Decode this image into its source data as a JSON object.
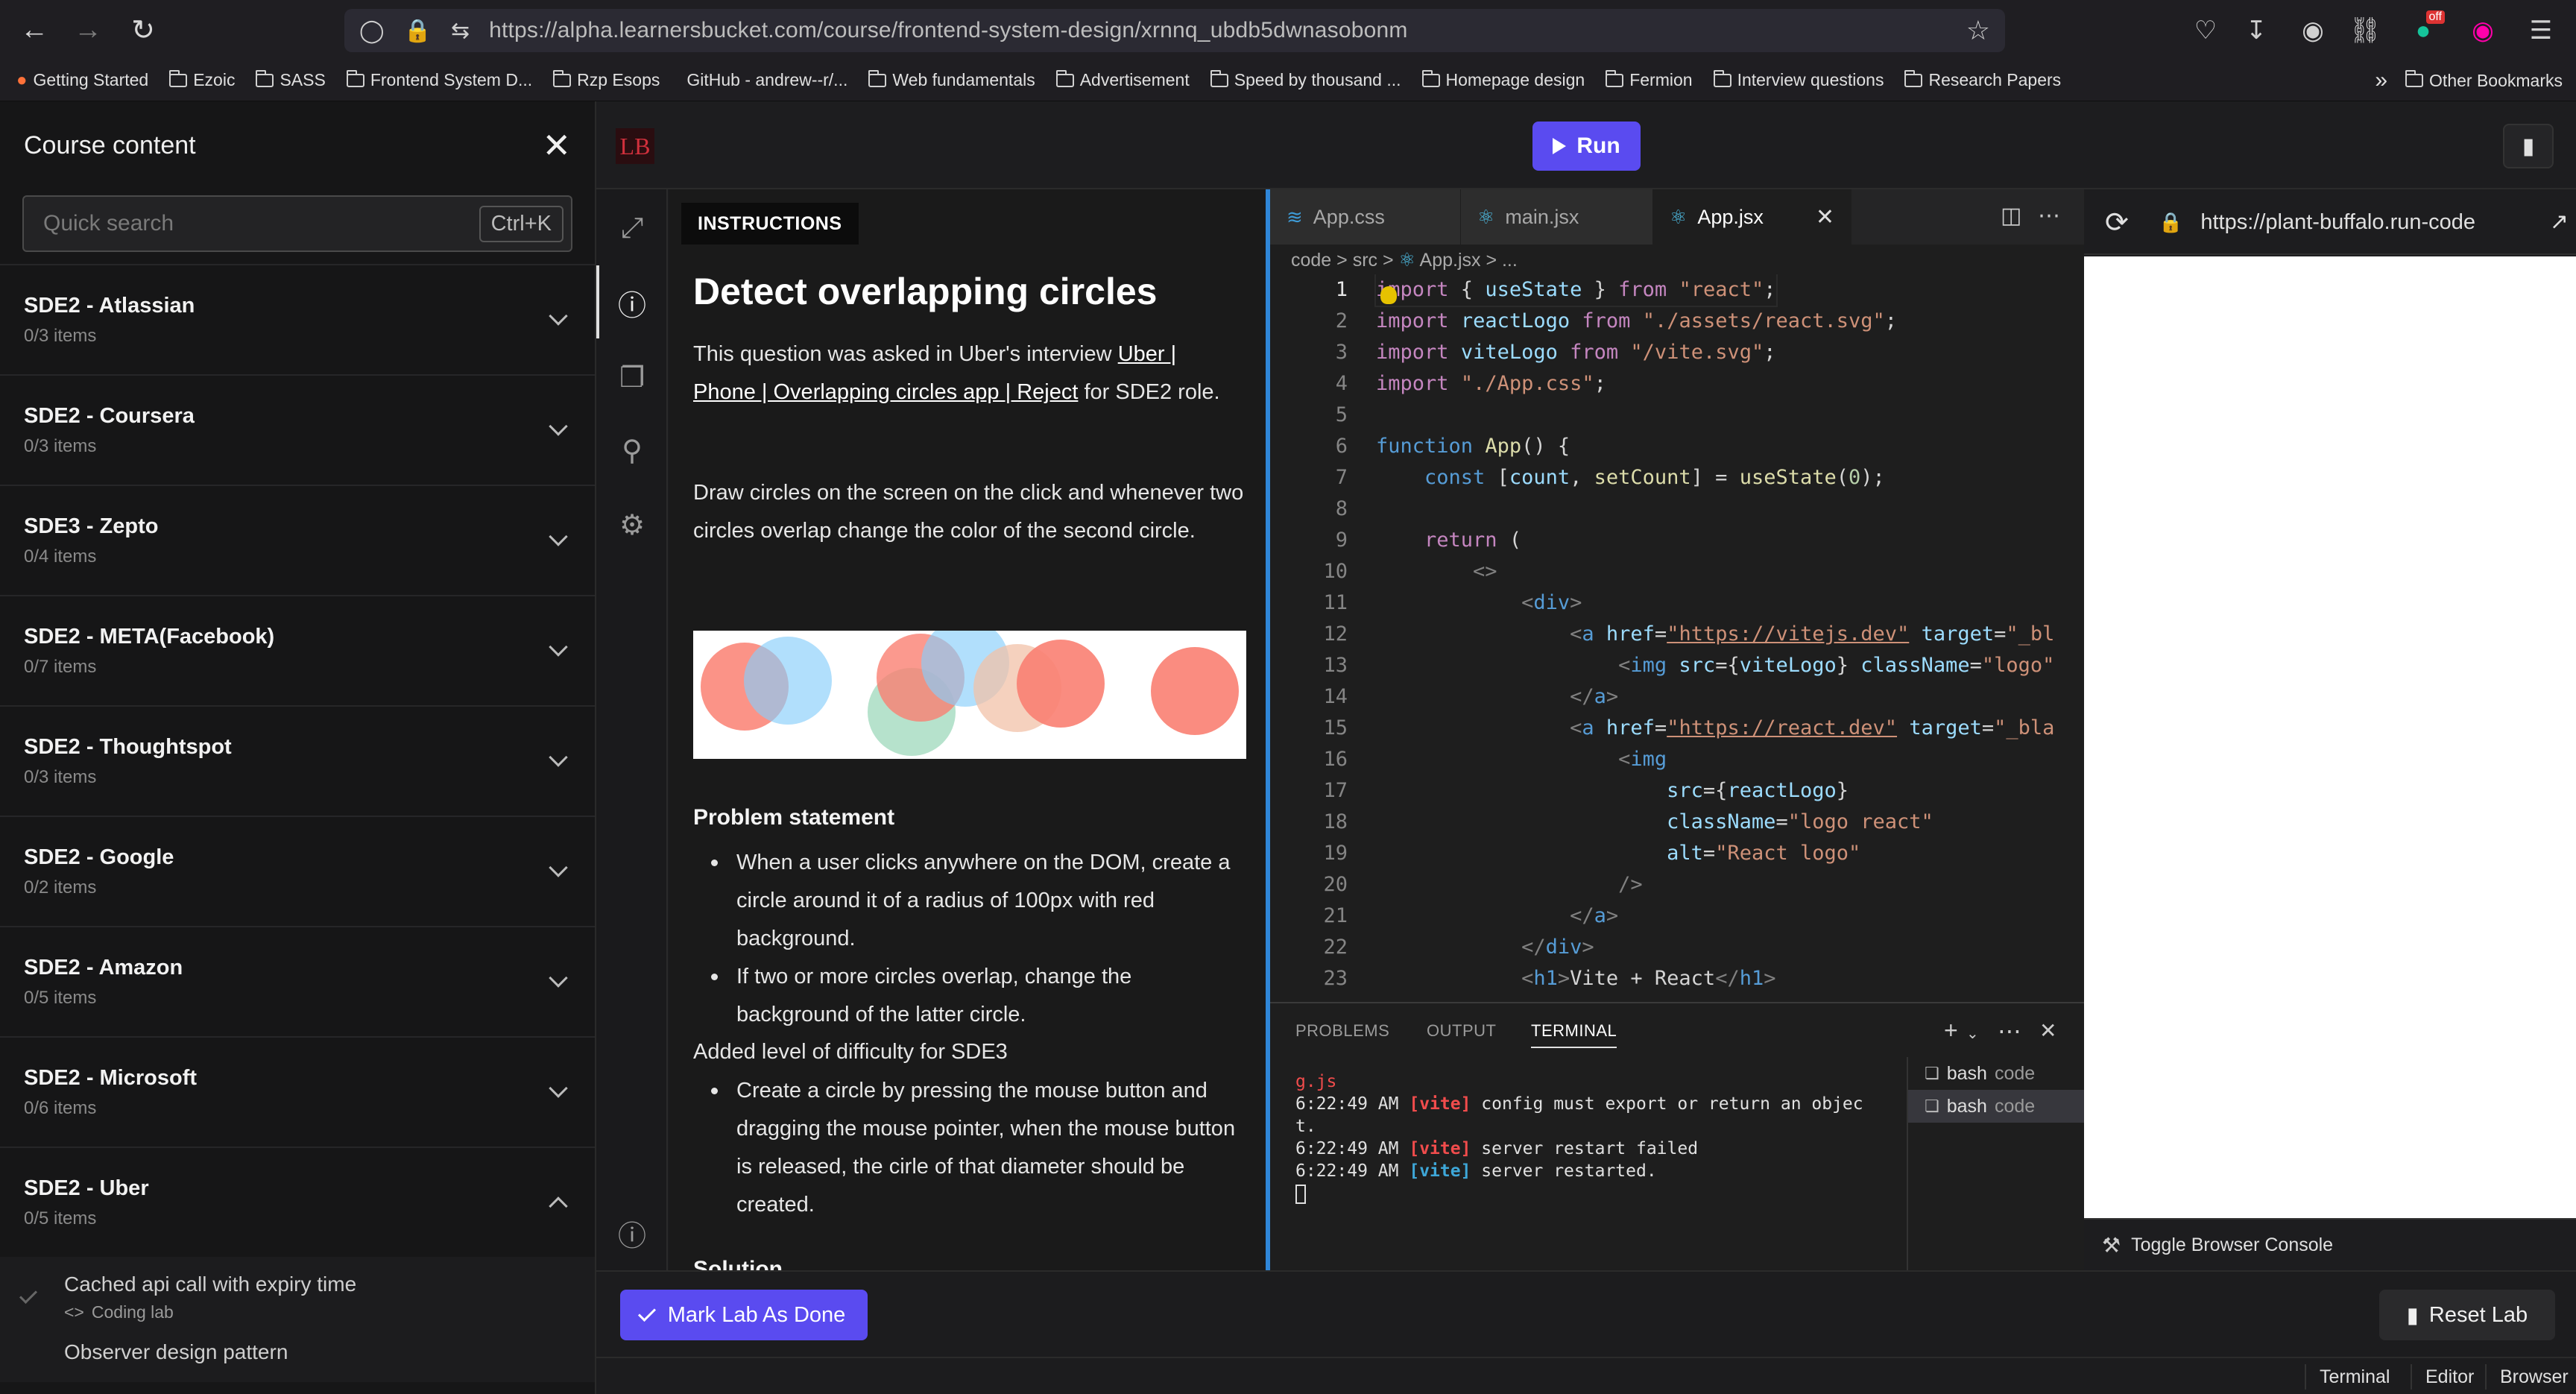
{
  "browser": {
    "url": "https://alpha.learnersbucket.com/course/frontend-system-design/xrnnq_ubdb5dwnasobonm",
    "bookmarks": [
      "Getting Started",
      "Ezoic",
      "SASS",
      "Frontend System D...",
      "Rzp Esops",
      "GitHub - andrew--r/...",
      "Web fundamentals",
      "Advertisement",
      "Speed by thousand ...",
      "Homepage design",
      "Fermion",
      "Interview questions",
      "Research Papers"
    ],
    "other_bookmarks": "Other Bookmarks",
    "ext_badge": "off"
  },
  "sidebar": {
    "title": "Course content",
    "search_placeholder": "Quick search",
    "search_shortcut": "Ctrl+K",
    "sections": [
      {
        "title": "SDE2 - Atlassian",
        "count": "0/3 items"
      },
      {
        "title": "SDE2 - Coursera",
        "count": "0/3 items"
      },
      {
        "title": "SDE3 - Zepto",
        "count": "0/4 items"
      },
      {
        "title": "SDE2 - META(Facebook)",
        "count": "0/7 items"
      },
      {
        "title": "SDE2 - Thoughtspot",
        "count": "0/3 items"
      },
      {
        "title": "SDE2 - Google",
        "count": "0/2 items"
      },
      {
        "title": "SDE2 - Amazon",
        "count": "0/5 items"
      },
      {
        "title": "SDE2 - Microsoft",
        "count": "0/6 items"
      },
      {
        "title": "SDE2 - Uber",
        "count": "0/5 items"
      }
    ],
    "lessons": [
      {
        "title": "Cached api call with expiry time",
        "type": "Coding lab"
      },
      {
        "title": "Observer design pattern",
        "type": ""
      }
    ]
  },
  "lab": {
    "logo": "LB",
    "run_label": "Run",
    "mark_done_label": "Mark Lab As Done",
    "reset_label": "Reset Lab",
    "view_buttons": [
      "Terminal",
      "Editor",
      "Browser"
    ]
  },
  "instructions": {
    "tab": "INSTRUCTIONS",
    "title": "Detect overlapping circles",
    "intro_pre": "This question was asked in Uber's interview ",
    "intro_link": "Uber | Phone | Overlapping circles app | Reject",
    "intro_post": " for SDE2 role.",
    "description": "Draw circles on the screen on the click and whenever two circles overlap change the color of the second circle.",
    "problem_heading": "Problem statement",
    "problem_points": [
      "When a user clicks anywhere on the DOM, create a circle around it of a radius of 100px with red background.",
      "If two or more circles overlap, change the background of the latter circle."
    ],
    "sde3_heading": "Added level of difficulty for SDE3",
    "sde3_points": [
      "Create a circle by pressing the mouse button and dragging the mouse pointer, when the mouse button is released, the cirle of that diameter should be created."
    ],
    "solution_heading": "Solution"
  },
  "editor": {
    "tabs": [
      "App.css",
      "main.jsx",
      "App.jsx"
    ],
    "breadcrumb": "code > src > ",
    "breadcrumb_file": "App.jsx",
    "breadcrumb_tail": " > ...",
    "line_numbers": [
      "1",
      "2",
      "3",
      "4",
      "5",
      "6",
      "7",
      "8",
      "9",
      "10",
      "11",
      "12",
      "13",
      "14",
      "15",
      "16",
      "17",
      "18",
      "19",
      "20",
      "21",
      "22",
      "23"
    ]
  },
  "terminal": {
    "tabs": [
      "PROBLEMS",
      "OUTPUT",
      "TERMINAL"
    ],
    "line0": "g.js",
    "time": "6:22:49 AM",
    "vite": "[vite]",
    "msg1": " config must export or return an objec",
    "msg1b": "t.",
    "msg2": " server restart failed",
    "msg3": " server restarted.",
    "sessions": [
      {
        "name": "bash",
        "sub": "code"
      },
      {
        "name": "bash",
        "sub": "code"
      }
    ]
  },
  "preview": {
    "url": "https://plant-buffalo.run-code",
    "console_toggle": "Toggle Browser Console"
  },
  "colors": {
    "accent": "#5a4bf0",
    "circle_red": "#fa8072",
    "circle_blue": "#87cefa",
    "circle_green": "#8fd3b0",
    "circle_peach": "#f2c1a8"
  }
}
